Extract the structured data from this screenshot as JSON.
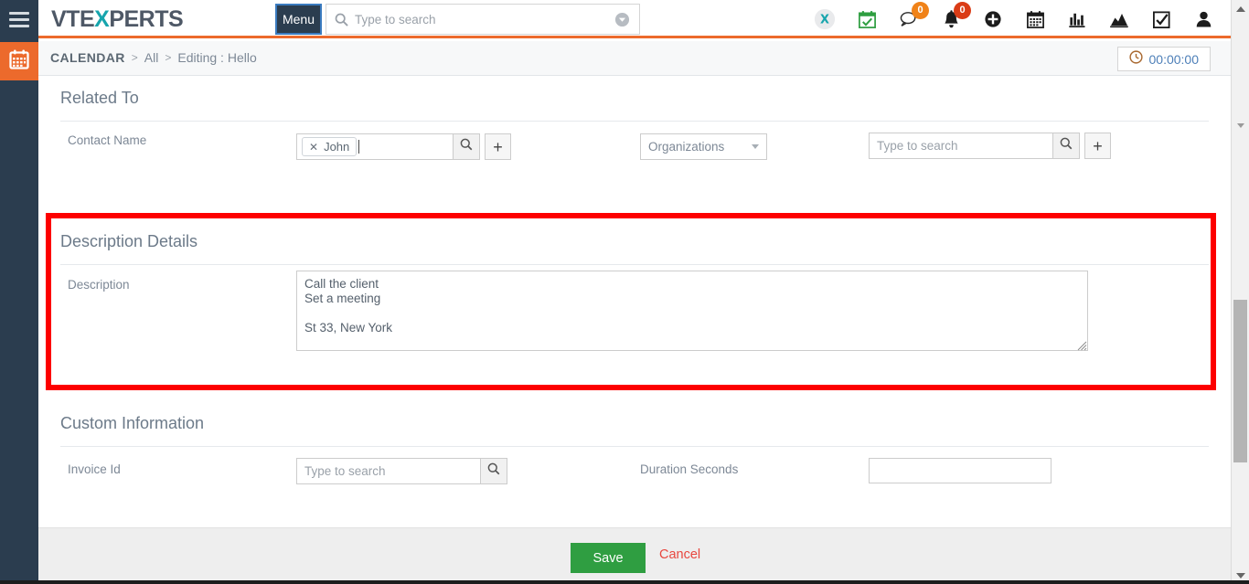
{
  "topbar": {
    "hamburger_icon": "hamburger-icon",
    "logo_part1": "VTE",
    "logo_part2": "X",
    "logo_part3": "PERTS",
    "menu_label": "Menu",
    "search_placeholder": "Type to search",
    "search_value": "",
    "search_icon": "search-icon",
    "search_toggle_icon": "chevron-down-circle-icon",
    "icons": [
      {
        "name": "xtreme-logo-icon",
        "badge": null
      },
      {
        "name": "calendar-check-icon",
        "badge": null
      },
      {
        "name": "chat-bubble-icon",
        "badge": "0",
        "badge_color": "#f08218"
      },
      {
        "name": "bell-icon",
        "badge": "0",
        "badge_color": "#da3c16"
      },
      {
        "name": "add-circle-icon",
        "badge": null
      },
      {
        "name": "calendar-grid-icon",
        "badge": null
      },
      {
        "name": "bar-chart-icon",
        "badge": null
      },
      {
        "name": "area-chart-icon",
        "badge": null
      },
      {
        "name": "checkbox-task-icon",
        "badge": null
      },
      {
        "name": "user-account-icon",
        "badge": null
      }
    ]
  },
  "rail": {
    "calendar_icon": "calendar-icon"
  },
  "breadcrumb": {
    "module": "CALENDAR",
    "separator": ">",
    "link": "All",
    "current": "Editing : Hello"
  },
  "timer": {
    "icon": "clock-icon",
    "value": "00:00:00"
  },
  "sections": {
    "related_to": {
      "title": "Related To",
      "contact_name_label": "Contact Name",
      "contact_token": "John",
      "contact_token_remove_icon": "close-x-icon",
      "search_icon": "search-icon",
      "add_icon": "plus-icon",
      "org_select_value": "Organizations",
      "org_select_caret_icon": "chevron-down-icon",
      "org_search_placeholder": "Type to search",
      "org_search_value": ""
    },
    "description_details": {
      "title": "Description Details",
      "description_label": "Description",
      "description_value": "Call the client\nSet a meeting\n\nSt 33, New York",
      "resize_grip_icon": "resize-grip-icon",
      "highlight_color": "#fd0000"
    },
    "custom_information": {
      "title": "Custom Information",
      "invoice_id_label": "Invoice Id",
      "invoice_id_placeholder": "Type to search",
      "invoice_id_value": "",
      "invoice_search_icon": "search-icon",
      "duration_seconds_label": "Duration Seconds",
      "duration_seconds_value": ""
    }
  },
  "footer": {
    "save_label": "Save",
    "save_color": "#2f9e41",
    "cancel_label": "Cancel",
    "cancel_color": "#e8473f"
  },
  "scrollbar": {
    "up_arrow_icon": "triangle-up-icon",
    "down_arrow_icon": "triangle-down-icon",
    "thumb": "scrollbar-thumb"
  },
  "theme": {
    "rail_bg": "#2b3d4f",
    "accent_orange": "#ec6a2c",
    "teal": "#17a5ad"
  }
}
